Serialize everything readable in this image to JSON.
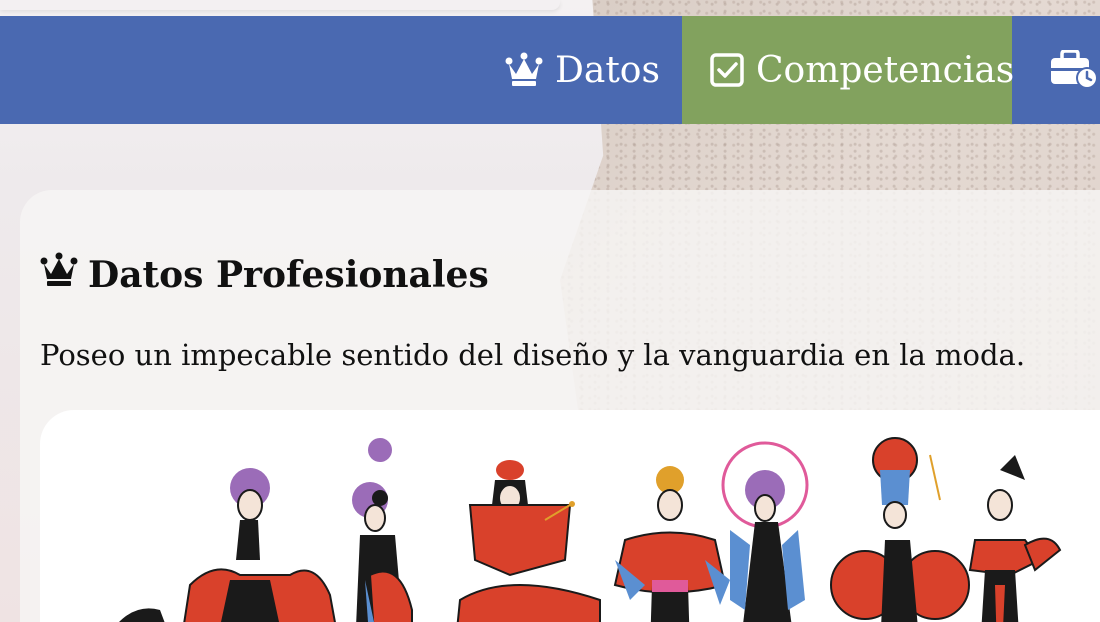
{
  "nav": {
    "items": [
      {
        "label": "Datos",
        "icon": "crown-icon",
        "active": false
      },
      {
        "label": "Competencias",
        "icon": "checkbox-icon",
        "active": true
      },
      {
        "label": "",
        "icon": "toolbox-clock-icon",
        "active": false
      }
    ],
    "colors": {
      "bar": "#4a69b1",
      "active": "#82a25e"
    }
  },
  "section": {
    "title": "Datos Profesionales",
    "icon": "crown-icon",
    "description": "Poseo un impecable sentido del diseño y la vanguardia en la moda."
  },
  "illustration": {
    "subject": "fashion-figures-illustration",
    "palette": [
      "#d9412b",
      "#1a1a1a",
      "#5b8fd1",
      "#9b6cb8",
      "#e05a9a"
    ]
  }
}
